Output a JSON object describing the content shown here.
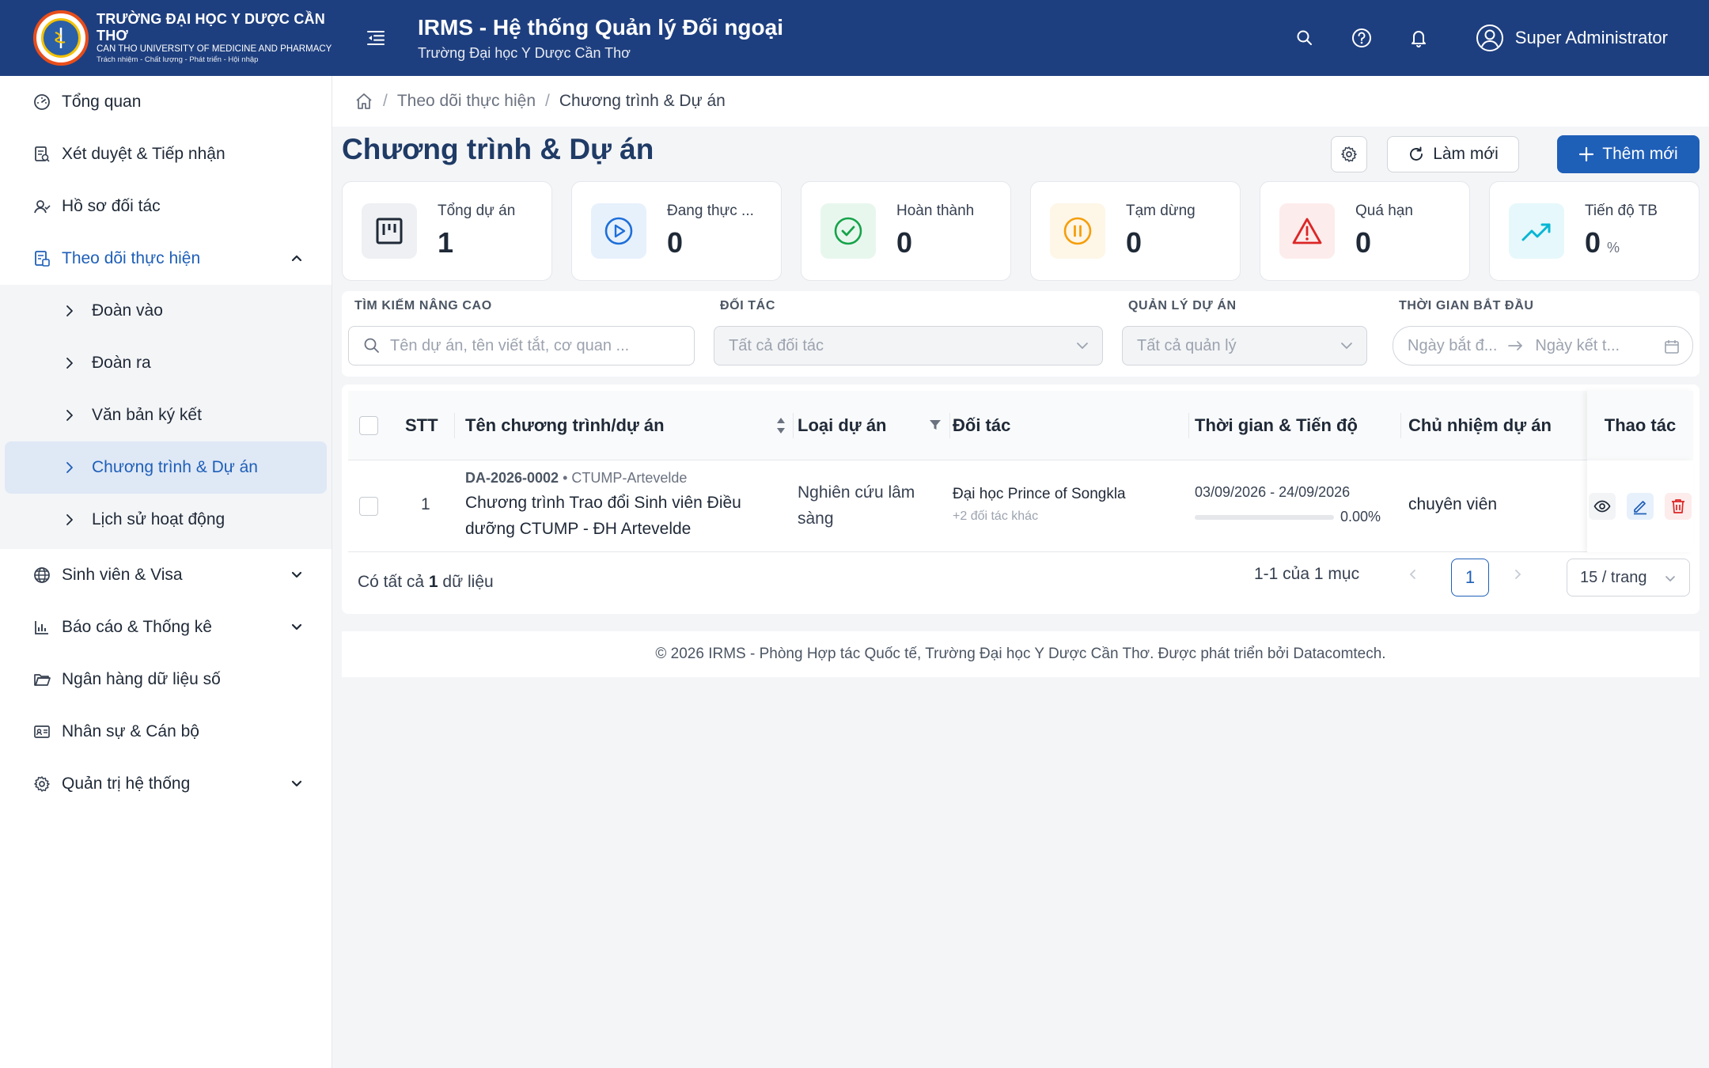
{
  "header": {
    "logo": {
      "line1": "TRƯỜNG ĐẠI HỌC Y DƯỢC CẦN THƠ",
      "line2": "CAN THO UNIVERSITY OF MEDICINE AND PHARMACY",
      "line3": "Trách nhiệm - Chất lượng - Phát triển - Hội nhập"
    },
    "title": "IRMS - Hệ thống Quản lý Đối ngoại",
    "subtitle": "Trường Đại học Y Dược Cần Thơ",
    "user_name": "Super Administrator"
  },
  "sidebar": {
    "items": [
      {
        "label": "Tổng quan",
        "icon": "dashboard-icon"
      },
      {
        "label": "Xét duyệt & Tiếp nhận",
        "icon": "review-icon"
      },
      {
        "label": "Hồ sơ đối tác",
        "icon": "partner-icon"
      },
      {
        "label": "Theo dõi thực hiện",
        "icon": "tracking-icon",
        "expanded": true
      },
      {
        "label": "Sinh viên & Visa",
        "icon": "globe-icon"
      },
      {
        "label": "Báo cáo & Thống kê",
        "icon": "bar-chart-icon"
      },
      {
        "label": "Ngân hàng dữ liệu số",
        "icon": "folder-icon"
      },
      {
        "label": "Nhân sự & Cán bộ",
        "icon": "id-card-icon"
      },
      {
        "label": "Quản trị hệ thống",
        "icon": "gear-icon"
      }
    ],
    "submenu": [
      {
        "label": "Đoàn vào"
      },
      {
        "label": "Đoàn ra"
      },
      {
        "label": "Văn bản ký kết"
      },
      {
        "label": "Chương trình & Dự án",
        "active": true
      },
      {
        "label": "Lịch sử hoạt động"
      }
    ]
  },
  "breadcrumb": {
    "parent": "Theo dõi thực hiện",
    "current": "Chương trình & Dự án"
  },
  "page": {
    "title": "Chương trình & Dự án",
    "refresh_label": "Làm mới",
    "add_label": "Thêm mới"
  },
  "stats": [
    {
      "label": "Tổng dự án",
      "value": "1",
      "unit": "",
      "color": "#374151",
      "bg": "#eef0f3",
      "icon": "kanban-icon"
    },
    {
      "label": "Đang thực ...",
      "value": "0",
      "unit": "",
      "color": "#1e6fd9",
      "bg": "#e7f1fc",
      "icon": "play-icon"
    },
    {
      "label": "Hoàn thành",
      "value": "0",
      "unit": "",
      "color": "#16a34a",
      "bg": "#e8f7ee",
      "icon": "check-circle-icon"
    },
    {
      "label": "Tạm dừng",
      "value": "0",
      "unit": "",
      "color": "#f59e0b",
      "bg": "#fef6e7",
      "icon": "pause-icon"
    },
    {
      "label": "Quá hạn",
      "value": "0",
      "unit": "",
      "color": "#dc2626",
      "bg": "#fdecec",
      "icon": "warning-icon"
    },
    {
      "label": "Tiến độ TB",
      "value": "0",
      "unit": "%",
      "color": "#06b6d4",
      "bg": "#e6f8fb",
      "icon": "trend-up-icon"
    }
  ],
  "filters": {
    "search_label": "TÌM KIẾM NÂNG CAO",
    "search_placeholder": "Tên dự án, tên viết tắt, cơ quan ...",
    "partner_label": "ĐỐI TÁC",
    "partner_value": "Tất cả đối tác",
    "manager_label": "QUẢN LÝ DỰ ÁN",
    "manager_value": "Tất cả quản lý",
    "date_label": "THỜI GIAN BẮT ĐẦU",
    "date_start": "Ngày bắt đ...",
    "date_end": "Ngày kết t..."
  },
  "table": {
    "columns": [
      "STT",
      "Tên chương trình/dự án",
      "Loại dự án",
      "Đối tác",
      "Thời gian & Tiến độ",
      "Chủ nhiệm dự án",
      "Thao tác"
    ],
    "rows": [
      {
        "stt": "1",
        "code": "DA-2026-0002",
        "short": " • CTUMP-Artevelde",
        "name": "Chương trình Trao đổi Sinh viên Điều dưỡng CTUMP - ĐH Artevelde",
        "type": "Nghiên cứu lâm sàng",
        "partner": "Đại học Prince of Songkla",
        "partner_more": "+2 đối tác khác",
        "dates": "03/09/2026 - 24/09/2026",
        "progress": 0,
        "progress_text": "0.00%",
        "manager": "chuyên viên"
      }
    ]
  },
  "pagination": {
    "total_prefix": "Có tất cả ",
    "total_count": "1",
    "total_suffix": " dữ liệu",
    "range": "1-1 của 1 mục",
    "current_page": "1",
    "page_size": "15 / trang"
  },
  "footer": {
    "text": "© 2026 IRMS - Phòng Hợp tác Quốc tế, Trường Đại học Y Dược Cần Thơ. Được phát triển bởi Datacomtech."
  },
  "colors": {
    "header_bg": "#1e3f7f",
    "accent": "#1e5fb8"
  }
}
